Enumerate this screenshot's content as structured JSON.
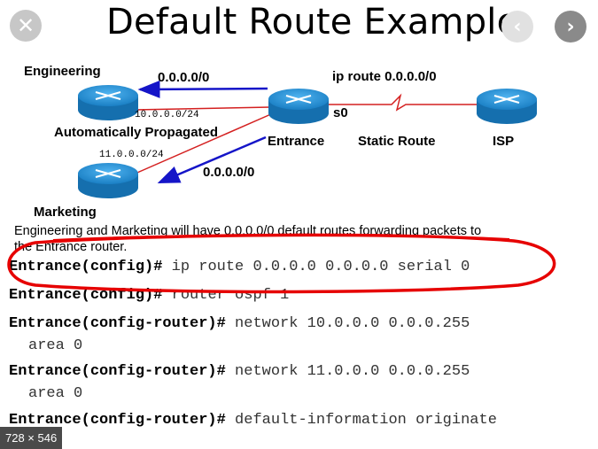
{
  "viewer": {
    "title": "Default Route Example",
    "image_size": "728 × 546"
  },
  "diagram": {
    "routers": {
      "engineering": "Engineering",
      "marketing": "Marketing",
      "entrance": "Entrance",
      "isp": "ISP"
    },
    "labels": {
      "default_route_top": "0.0.0.0/0",
      "ip_route_cmd": "ip route 0.0.0.0/0",
      "interface_s0": "s0",
      "static_route": "Static Route",
      "auto_propagated": "Automatically Propagated",
      "default_route_bottom": "0.0.0.0/0",
      "net_engineering": "10.0.0.0/24",
      "net_marketing": "11.0.0.0/24"
    },
    "colors": {
      "router": "#1e90d6",
      "arrow": "#1515c8",
      "link": "#d42020",
      "highlight": "#e60000"
    }
  },
  "config": {
    "description_line1": "Engineering and Marketing will have 0.0.0.0/0 default routes forwarding packets to",
    "description_line2": "the Entrance router.",
    "lines": [
      {
        "prompt": "Entrance(config)#",
        "command": "ip route 0.0.0.0 0.0.0.0 serial 0"
      },
      {
        "prompt": "Entrance(config)#",
        "command": "router ospf 1"
      },
      {
        "prompt": "Entrance(config-router)#",
        "command": "network 10.0.0.0 0.0.0.255"
      },
      {
        "prompt": "Entrance(config-router)#",
        "command": "network 11.0.0.0 0.0.0.255"
      },
      {
        "prompt": "Entrance(config-router)#",
        "command": "default-information originate"
      }
    ],
    "continuations": [
      "area 0",
      "area 0"
    ]
  }
}
